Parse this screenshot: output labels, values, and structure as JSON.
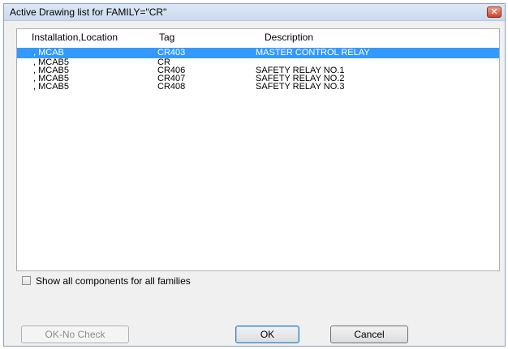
{
  "window": {
    "title": "Active Drawing list for FAMILY=\"CR\"",
    "close_glyph": "✕"
  },
  "list": {
    "columns": [
      "Installation,Location",
      "Tag",
      "Description"
    ],
    "rows": [
      {
        "location": ", MCAB",
        "tag": "CR403",
        "description": "MASTER CONTROL RELAY",
        "selected": true
      },
      {
        "location": ", MCAB5",
        "tag": "CR",
        "description": "",
        "selected": false
      },
      {
        "location": ", MCAB5",
        "tag": "CR406",
        "description": "SAFETY RELAY NO.1",
        "selected": false
      },
      {
        "location": ", MCAB5",
        "tag": "CR407",
        "description": "SAFETY RELAY NO.2",
        "selected": false
      },
      {
        "location": ", MCAB5",
        "tag": "CR408",
        "description": "SAFETY RELAY NO.3",
        "selected": false
      }
    ]
  },
  "options": {
    "show_all_label": "Show all components for all families",
    "show_all_checked": false
  },
  "buttons": {
    "ok_no_check": "OK-No Check",
    "ok": "OK",
    "cancel": "Cancel"
  },
  "colors": {
    "selection": "#3399ff",
    "close_button": "#c7442c"
  }
}
